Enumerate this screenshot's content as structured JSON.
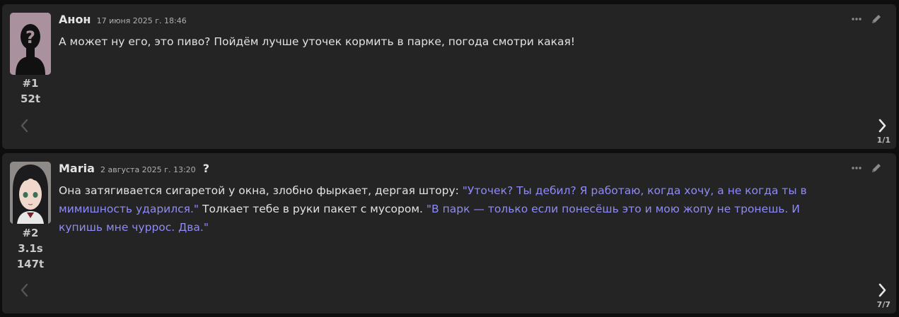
{
  "messages": [
    {
      "author": "Анон",
      "date": "17 июня 2025 г. 18:46",
      "index": "#1",
      "tokens": "52t",
      "text": "А может ну его, это пиво? Пойдём лучше уточек кормить в парке, погода смотри какая!",
      "counter": "1/1",
      "avatar_icon": "anonymous-silhouette"
    },
    {
      "author": "Maria",
      "date": "2 августа 2025 г. 13:20",
      "info_mark": "?",
      "index": "#2",
      "time": "3.1s",
      "tokens": "147t",
      "segments": [
        "Она затягивается сигаретой у окна, злобно фыркает, дергая штору: ",
        "\"Уточек? Ты дебил? Я работаю, когда хочу, а не когда ты в мимишность ударился.\"",
        " Толкает тебе в руки пакет с мусором. ",
        "\"В парк — только если понесёшь это и мою жопу не тронешь. И купишь мне чуррос. Два.\""
      ],
      "counter": "7/7",
      "avatar_icon": "anime-girl-portrait"
    }
  ],
  "icons": {
    "more": "ellipsis-icon",
    "edit": "pencil-icon",
    "prev": "chevron-left-icon",
    "next": "chevron-right-icon"
  },
  "colors": {
    "background": "#0e0e0e",
    "card": "#242424",
    "text": "#e2e2e2",
    "quote": "#8f8bf5"
  }
}
